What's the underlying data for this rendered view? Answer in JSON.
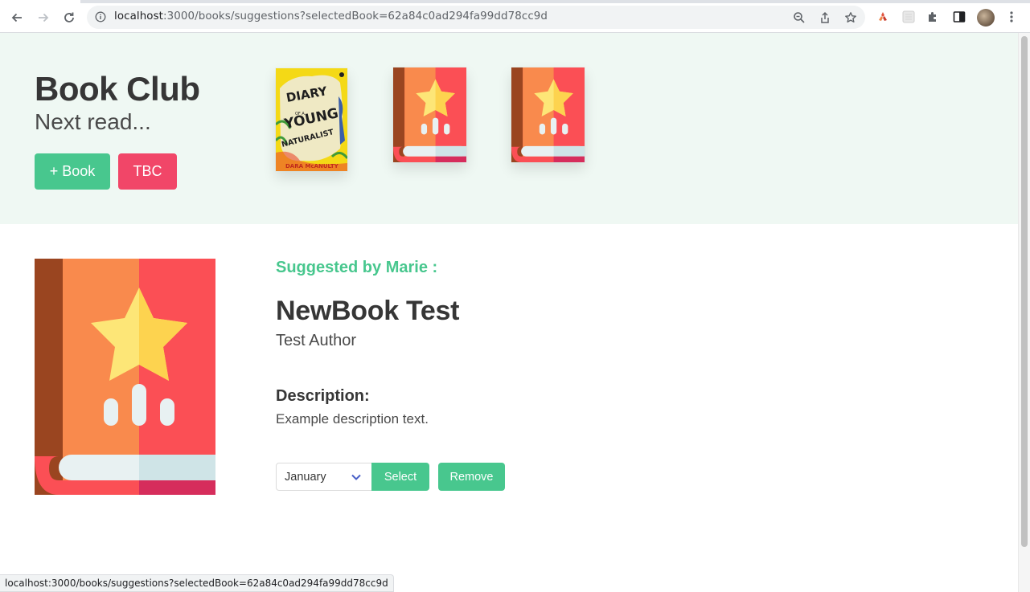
{
  "browser": {
    "url_host": "localhost",
    "url_rest": ":3000/books/suggestions?selectedBook=62a84c0ad294fa99dd78cc9d",
    "status_url": "localhost:3000/books/suggestions?selectedBook=62a84c0ad294fa99dd78cc9d"
  },
  "hero": {
    "title": "Book Club",
    "subtitle": "Next read...",
    "add_button": "+ Book",
    "tbc_button": "TBC",
    "covers": [
      {
        "type": "diary-cover",
        "text_lines": [
          "DIARY",
          "OF A",
          "YOUNG",
          "NATURALIST",
          "DARA McANULTY"
        ]
      },
      {
        "type": "generic-book-icon"
      },
      {
        "type": "generic-book-icon"
      }
    ]
  },
  "suggestion": {
    "suggested_by": "Suggested by Marie :",
    "title": "NewBook Test",
    "author": "Test Author",
    "description_label": "Description:",
    "description": "Example description text.",
    "month_select": "January",
    "select_button": "Select",
    "remove_button": "Remove"
  },
  "colors": {
    "primary": "#48c78e",
    "danger": "#f14668",
    "hero_bg": "#eff8f3"
  }
}
